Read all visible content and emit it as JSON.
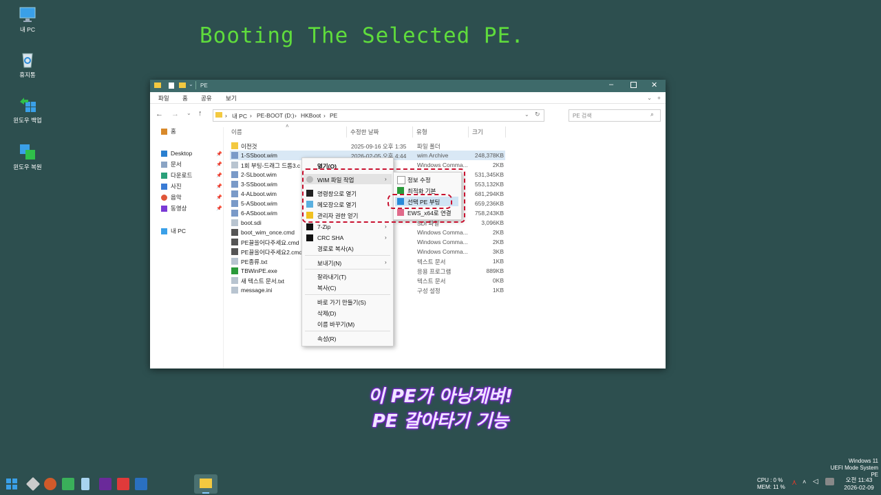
{
  "overlay": {
    "title": "Booting The Selected PE.",
    "caption_line1": "이 PE가 아닝게벼!",
    "caption_line2": "PE 갈아타기 기능"
  },
  "desktop_icons": [
    {
      "label": "내 PC"
    },
    {
      "label": "휴지통"
    },
    {
      "label": "윈도우 백업"
    },
    {
      "label": "윈도우 복원"
    }
  ],
  "window": {
    "title": "PE",
    "menu": [
      "파일",
      "홈",
      "공유",
      "보기"
    ],
    "breadcrumb": [
      "내 PC",
      "PE-BOOT (D:)",
      "HKBoot",
      "PE"
    ],
    "search_placeholder": "PE 검색",
    "nav": [
      {
        "label": "홈"
      },
      {
        "label": "Desktop"
      },
      {
        "label": "문서"
      },
      {
        "label": "다운로드"
      },
      {
        "label": "사진"
      },
      {
        "label": "음악"
      },
      {
        "label": "동영상"
      },
      {
        "label": "내 PC"
      }
    ],
    "columns": {
      "name": "이름",
      "date": "수정한 날짜",
      "type": "유형",
      "size": "크기"
    },
    "files": [
      {
        "name": "이전것",
        "date": "2025-09-16 오후 1:35",
        "type": "파일 폴더",
        "size": ""
      },
      {
        "name": "1-SSboot.wim",
        "date": "2026-02-05 오후 4:44",
        "type": "wim Archive",
        "size": "248,378KB"
      },
      {
        "name": "1회 부팅-드래그 드롭3.c",
        "date": "1:53",
        "type": "Windows Comma...",
        "size": "2KB"
      },
      {
        "name": "2-SLboot.wim",
        "date": "",
        "type": "",
        "size": "531,345KB"
      },
      {
        "name": "3-SSboot.wim",
        "date": "",
        "type": "",
        "size": "553,132KB"
      },
      {
        "name": "4-ALboot.wim",
        "date": "",
        "type": "",
        "size": "681,294KB"
      },
      {
        "name": "5-ASboot.wim",
        "date": "",
        "type": "",
        "size": "659,236KB"
      },
      {
        "name": "6-ASboot.wim",
        "date": "",
        "type": "",
        "size": "758,243KB"
      },
      {
        "name": "boot.sdi",
        "date": "1:11",
        "type": "SDI 파일",
        "size": "3,096KB"
      },
      {
        "name": "boot_wim_once.cmd",
        "date": "1:50",
        "type": "Windows Comma...",
        "size": "2KB"
      },
      {
        "name": "PE끌을어다주세요.cmd",
        "date": "9:18",
        "type": "Windows Comma...",
        "size": "2KB"
      },
      {
        "name": "PE끌을어다주세요2.cmd",
        "date": "11:25",
        "type": "Windows Comma...",
        "size": "3KB"
      },
      {
        "name": "PE종류.txt",
        "date": "10:15",
        "type": "텍스트 문서",
        "size": "1KB"
      },
      {
        "name": "TBWinPE.exe",
        "date": "11:04",
        "type": "응용 프로그램",
        "size": "889KB"
      },
      {
        "name": "새 텍스트 문서.txt",
        "date": "4:57",
        "type": "텍스트 문서",
        "size": "0KB"
      },
      {
        "name": "message.ini",
        "date": "2:12",
        "type": "구성 설정",
        "size": "1KB"
      }
    ]
  },
  "context_menu": {
    "items": [
      {
        "label": "열기(O)"
      },
      {
        "label": "WIM 파일 작업"
      },
      {
        "label": "명령창으로 열기"
      },
      {
        "label": "메모장으로 열기"
      },
      {
        "label": "관리자 권한 얻기"
      },
      {
        "label": "7-Zip"
      },
      {
        "label": "CRC SHA"
      },
      {
        "label": "경로로 복사(A)"
      },
      {
        "label": "보내기(N)"
      },
      {
        "label": "잘라내기(T)"
      },
      {
        "label": "복사(C)"
      },
      {
        "label": "바로 가기 만들기(S)"
      },
      {
        "label": "삭제(D)"
      },
      {
        "label": "이름 바꾸기(M)"
      },
      {
        "label": "속성(R)"
      }
    ],
    "submenu": [
      {
        "label": "정보 수정"
      },
      {
        "label": "최적화 기본"
      },
      {
        "label": "선택 PE 부팅"
      },
      {
        "label": "EWS_x64로 연결"
      }
    ]
  },
  "taskbar": {
    "cpu": "CPU :   0 %",
    "mem": "MEM: 11 %",
    "os_line1": "Windows 11",
    "os_line2": "UEFI Mode System PE",
    "time": "오전 11:43",
    "date": "2026-02-09"
  },
  "colors": {
    "desktop": "#2d4f4f",
    "titlebar": "#3e6a6a",
    "highlight": "#c8102e",
    "overlay_title": "#5fdc3c"
  }
}
